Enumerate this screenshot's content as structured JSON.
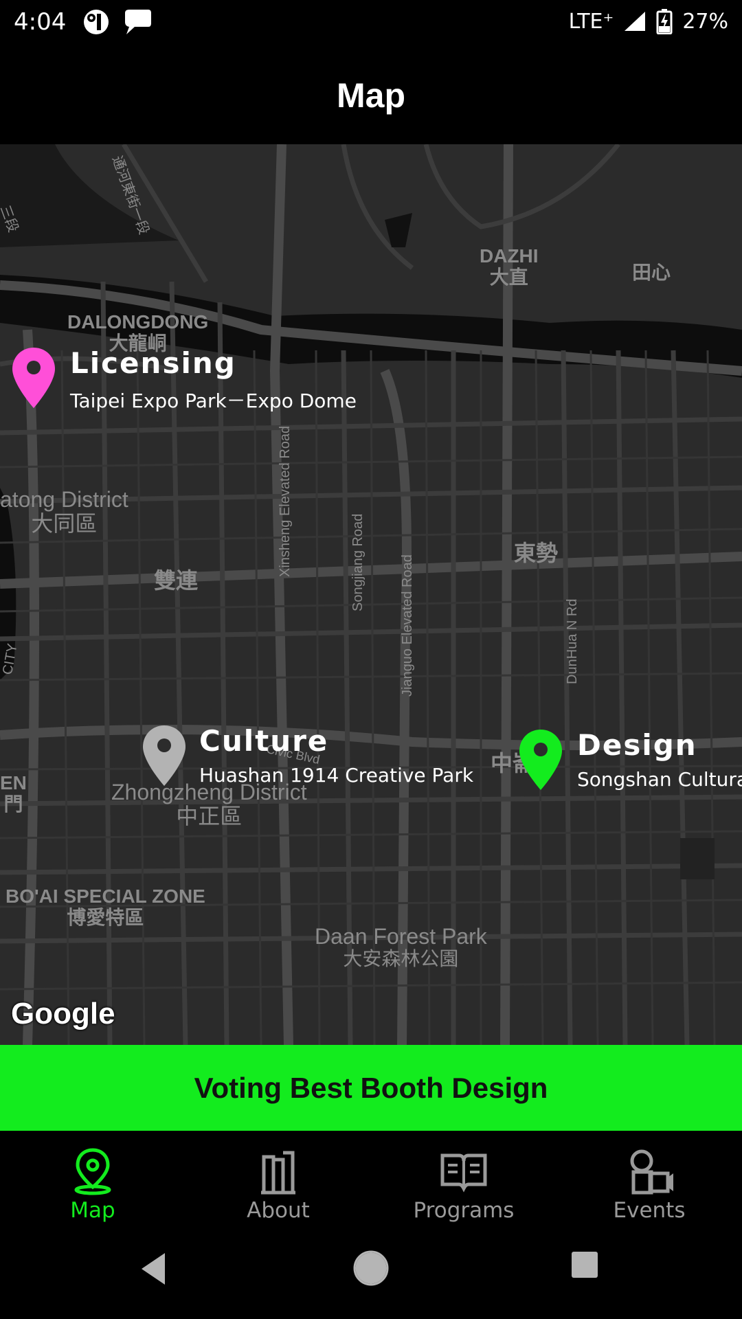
{
  "status_bar": {
    "time": "4:04",
    "network": "LTE⁺",
    "battery": "27%",
    "icons": [
      "assistant-icon",
      "chat-bubble-icon",
      "signal-icon",
      "battery-charging-icon"
    ]
  },
  "app_bar": {
    "title": "Map"
  },
  "map": {
    "area_labels": [
      {
        "en": "DAZHI",
        "zh": "大直"
      },
      {
        "zh": "田心"
      },
      {
        "en": "DALONGDONG",
        "zh": "大龍峒"
      },
      {
        "en": "atong District",
        "zh": "大同區"
      },
      {
        "zh": "雙連"
      },
      {
        "zh": "東勢"
      },
      {
        "en": "Zhongzheng District",
        "zh": "中正區"
      },
      {
        "en": "BO'AI SPECIAL ZONE",
        "zh": "博愛特區"
      },
      {
        "en": "Daan Forest Park",
        "zh": "大安森林公園"
      },
      {
        "en": "EN",
        "zh": "門"
      },
      {
        "zh": "中崙"
      },
      {
        "zh": "通河東街一段"
      },
      {
        "zh": "三段"
      },
      {
        "en": "CITY"
      }
    ],
    "road_labels": [
      "Xinsheng Elevated Road",
      "Songjiang Road",
      "Jianguo Elevated Road",
      "DunHua N Rd",
      "Civic Blvd"
    ],
    "markers": [
      {
        "category": "Licensing",
        "venue": "Taipei Expo Park－Expo Dome",
        "color": "#ff4fd8"
      },
      {
        "category": "Culture",
        "venue": "Huashan 1914 Creative Park",
        "color": "#b3b3b3"
      },
      {
        "category": "Design",
        "venue": "Songshan Cultural",
        "color": "#13ec1e"
      }
    ],
    "attribution": "Google"
  },
  "vote_button": {
    "label": "Voting Best Booth Design",
    "color": "#13ec1e"
  },
  "bottom_nav": {
    "items": [
      {
        "label": "Map",
        "icon": "map-pin-icon",
        "active": true
      },
      {
        "label": "About",
        "icon": "building-icon",
        "active": false
      },
      {
        "label": "Programs",
        "icon": "book-icon",
        "active": false
      },
      {
        "label": "Events",
        "icon": "events-icon",
        "active": false
      }
    ]
  },
  "system_nav": {
    "icons": [
      "back-icon",
      "home-icon",
      "recents-icon"
    ]
  }
}
